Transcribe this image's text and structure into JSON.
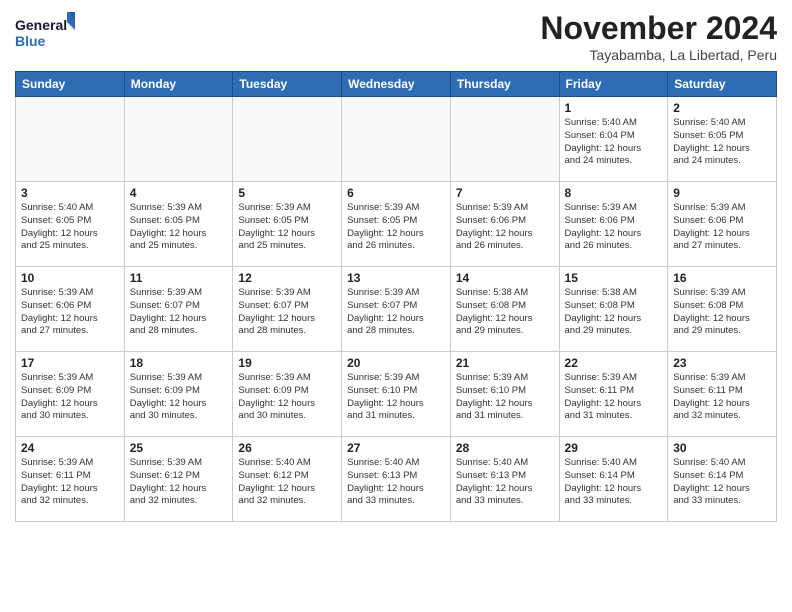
{
  "logo": {
    "line1": "General",
    "line2": "Blue"
  },
  "title": "November 2024",
  "location": "Tayabamba, La Libertad, Peru",
  "weekdays": [
    "Sunday",
    "Monday",
    "Tuesday",
    "Wednesday",
    "Thursday",
    "Friday",
    "Saturday"
  ],
  "weeks": [
    [
      {
        "day": "",
        "info": ""
      },
      {
        "day": "",
        "info": ""
      },
      {
        "day": "",
        "info": ""
      },
      {
        "day": "",
        "info": ""
      },
      {
        "day": "",
        "info": ""
      },
      {
        "day": "1",
        "info": "Sunrise: 5:40 AM\nSunset: 6:04 PM\nDaylight: 12 hours\nand 24 minutes."
      },
      {
        "day": "2",
        "info": "Sunrise: 5:40 AM\nSunset: 6:05 PM\nDaylight: 12 hours\nand 24 minutes."
      }
    ],
    [
      {
        "day": "3",
        "info": "Sunrise: 5:40 AM\nSunset: 6:05 PM\nDaylight: 12 hours\nand 25 minutes."
      },
      {
        "day": "4",
        "info": "Sunrise: 5:39 AM\nSunset: 6:05 PM\nDaylight: 12 hours\nand 25 minutes."
      },
      {
        "day": "5",
        "info": "Sunrise: 5:39 AM\nSunset: 6:05 PM\nDaylight: 12 hours\nand 25 minutes."
      },
      {
        "day": "6",
        "info": "Sunrise: 5:39 AM\nSunset: 6:05 PM\nDaylight: 12 hours\nand 26 minutes."
      },
      {
        "day": "7",
        "info": "Sunrise: 5:39 AM\nSunset: 6:06 PM\nDaylight: 12 hours\nand 26 minutes."
      },
      {
        "day": "8",
        "info": "Sunrise: 5:39 AM\nSunset: 6:06 PM\nDaylight: 12 hours\nand 26 minutes."
      },
      {
        "day": "9",
        "info": "Sunrise: 5:39 AM\nSunset: 6:06 PM\nDaylight: 12 hours\nand 27 minutes."
      }
    ],
    [
      {
        "day": "10",
        "info": "Sunrise: 5:39 AM\nSunset: 6:06 PM\nDaylight: 12 hours\nand 27 minutes."
      },
      {
        "day": "11",
        "info": "Sunrise: 5:39 AM\nSunset: 6:07 PM\nDaylight: 12 hours\nand 28 minutes."
      },
      {
        "day": "12",
        "info": "Sunrise: 5:39 AM\nSunset: 6:07 PM\nDaylight: 12 hours\nand 28 minutes."
      },
      {
        "day": "13",
        "info": "Sunrise: 5:39 AM\nSunset: 6:07 PM\nDaylight: 12 hours\nand 28 minutes."
      },
      {
        "day": "14",
        "info": "Sunrise: 5:38 AM\nSunset: 6:08 PM\nDaylight: 12 hours\nand 29 minutes."
      },
      {
        "day": "15",
        "info": "Sunrise: 5:38 AM\nSunset: 6:08 PM\nDaylight: 12 hours\nand 29 minutes."
      },
      {
        "day": "16",
        "info": "Sunrise: 5:39 AM\nSunset: 6:08 PM\nDaylight: 12 hours\nand 29 minutes."
      }
    ],
    [
      {
        "day": "17",
        "info": "Sunrise: 5:39 AM\nSunset: 6:09 PM\nDaylight: 12 hours\nand 30 minutes."
      },
      {
        "day": "18",
        "info": "Sunrise: 5:39 AM\nSunset: 6:09 PM\nDaylight: 12 hours\nand 30 minutes."
      },
      {
        "day": "19",
        "info": "Sunrise: 5:39 AM\nSunset: 6:09 PM\nDaylight: 12 hours\nand 30 minutes."
      },
      {
        "day": "20",
        "info": "Sunrise: 5:39 AM\nSunset: 6:10 PM\nDaylight: 12 hours\nand 31 minutes."
      },
      {
        "day": "21",
        "info": "Sunrise: 5:39 AM\nSunset: 6:10 PM\nDaylight: 12 hours\nand 31 minutes."
      },
      {
        "day": "22",
        "info": "Sunrise: 5:39 AM\nSunset: 6:11 PM\nDaylight: 12 hours\nand 31 minutes."
      },
      {
        "day": "23",
        "info": "Sunrise: 5:39 AM\nSunset: 6:11 PM\nDaylight: 12 hours\nand 32 minutes."
      }
    ],
    [
      {
        "day": "24",
        "info": "Sunrise: 5:39 AM\nSunset: 6:11 PM\nDaylight: 12 hours\nand 32 minutes."
      },
      {
        "day": "25",
        "info": "Sunrise: 5:39 AM\nSunset: 6:12 PM\nDaylight: 12 hours\nand 32 minutes."
      },
      {
        "day": "26",
        "info": "Sunrise: 5:40 AM\nSunset: 6:12 PM\nDaylight: 12 hours\nand 32 minutes."
      },
      {
        "day": "27",
        "info": "Sunrise: 5:40 AM\nSunset: 6:13 PM\nDaylight: 12 hours\nand 33 minutes."
      },
      {
        "day": "28",
        "info": "Sunrise: 5:40 AM\nSunset: 6:13 PM\nDaylight: 12 hours\nand 33 minutes."
      },
      {
        "day": "29",
        "info": "Sunrise: 5:40 AM\nSunset: 6:14 PM\nDaylight: 12 hours\nand 33 minutes."
      },
      {
        "day": "30",
        "info": "Sunrise: 5:40 AM\nSunset: 6:14 PM\nDaylight: 12 hours\nand 33 minutes."
      }
    ]
  ]
}
